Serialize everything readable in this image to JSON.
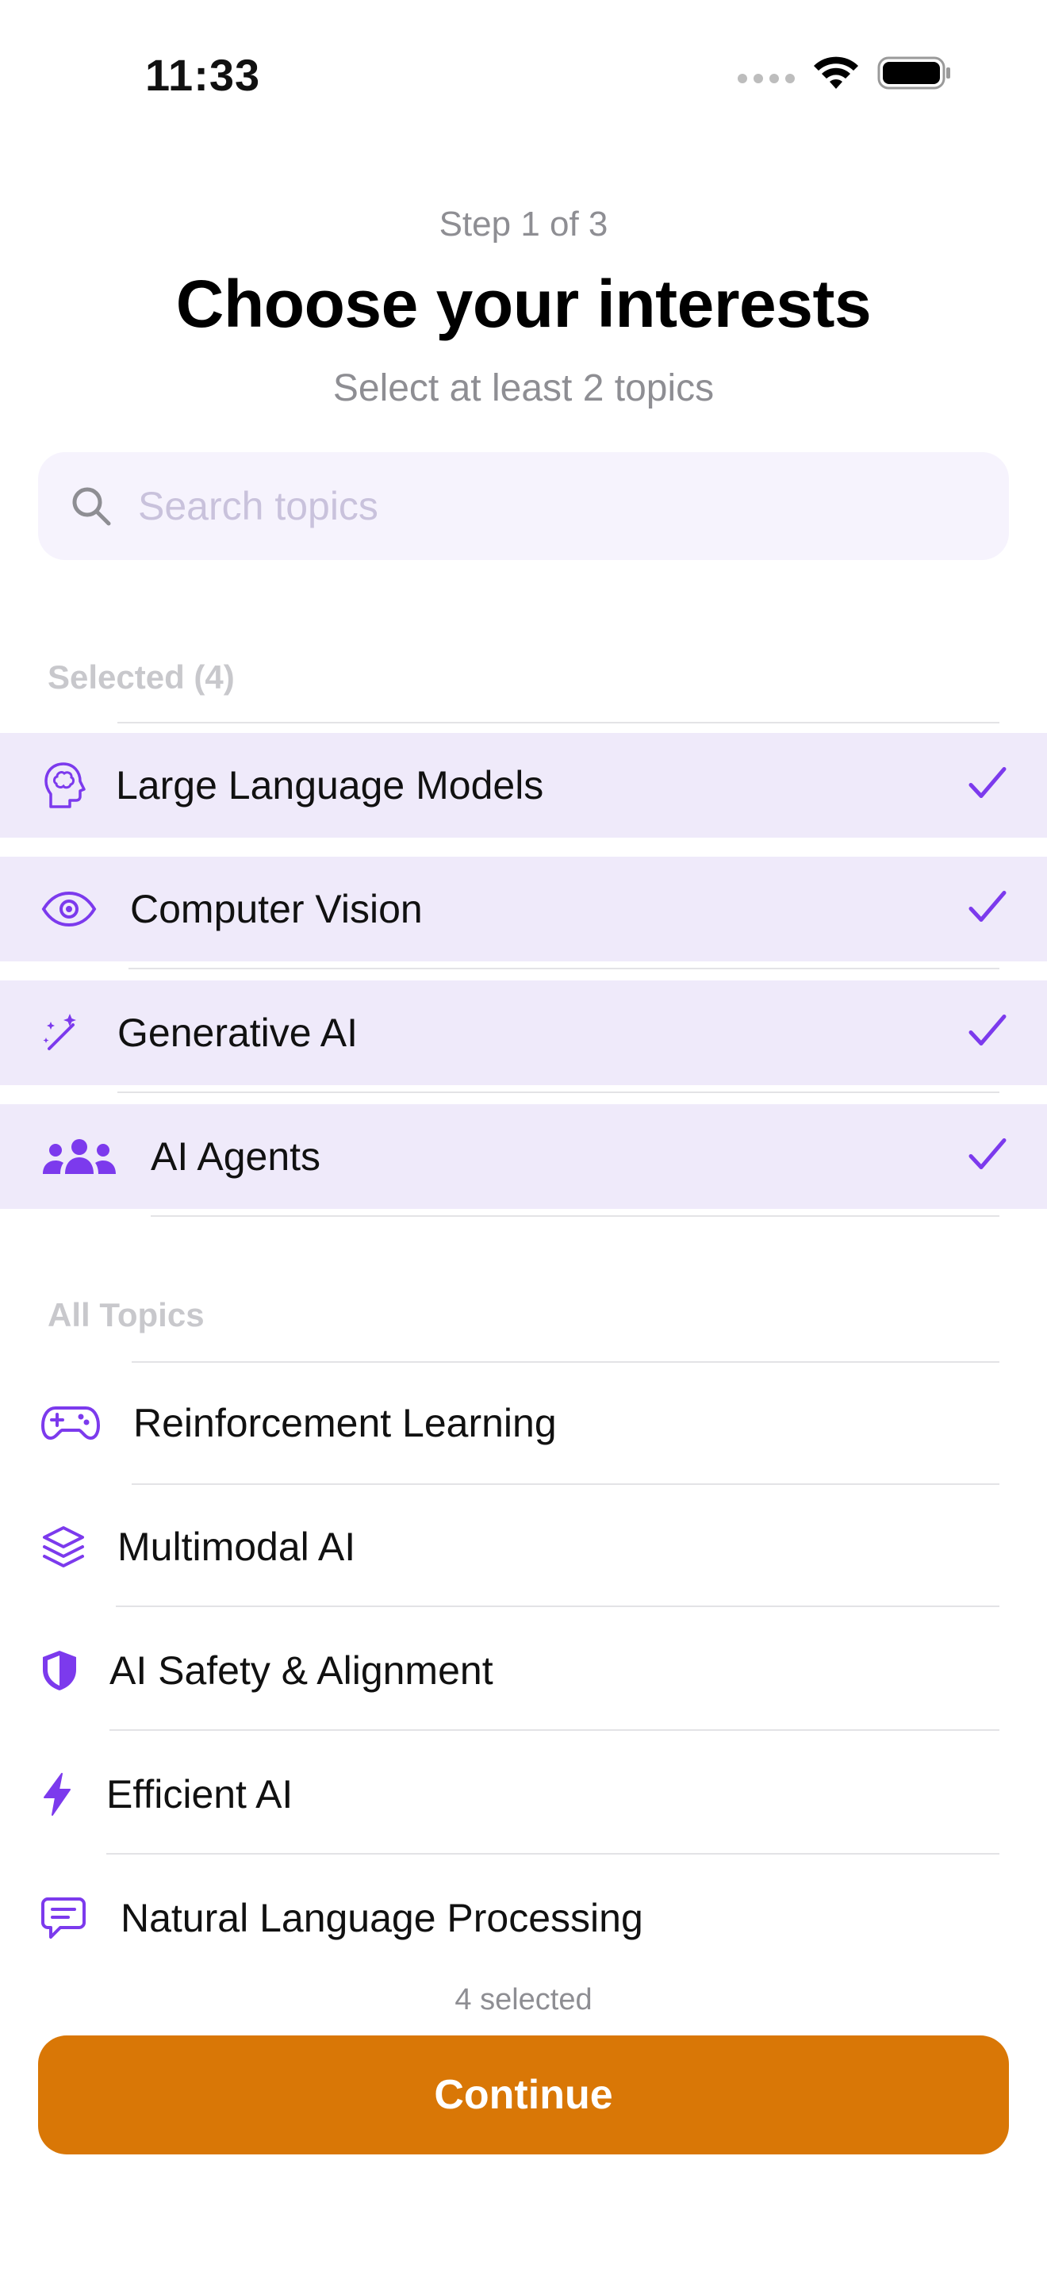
{
  "status_bar": {
    "time": "11:33"
  },
  "header": {
    "step": "Step 1 of 3",
    "title": "Choose your interests",
    "subtitle": "Select at least 2 topics"
  },
  "search": {
    "placeholder": "Search topics",
    "value": ""
  },
  "sections": {
    "selected_header": "Selected (4)",
    "all_header": "All Topics"
  },
  "selected_topics": [
    {
      "label": "Large Language Models",
      "icon": "brain-head-icon",
      "checked": true
    },
    {
      "label": "Computer Vision",
      "icon": "eye-icon",
      "checked": true
    },
    {
      "label": "Generative AI",
      "icon": "magic-wand-icon",
      "checked": true
    },
    {
      "label": "AI Agents",
      "icon": "users-group-icon",
      "checked": true
    }
  ],
  "all_topics": [
    {
      "label": "Reinforcement Learning",
      "icon": "gamepad-icon"
    },
    {
      "label": "Multimodal AI",
      "icon": "layers-icon"
    },
    {
      "label": "AI Safety & Alignment",
      "icon": "shield-icon"
    },
    {
      "label": "Efficient AI",
      "icon": "lightning-icon"
    },
    {
      "label": "Natural Language Processing",
      "icon": "chat-lines-icon"
    }
  ],
  "footer": {
    "selected_count": "4 selected",
    "continue_label": "Continue"
  },
  "colors": {
    "accent": "#7c3aed",
    "selected_bg": "#efeafa",
    "search_bg": "#f6f3fd",
    "button": "#d97706"
  }
}
